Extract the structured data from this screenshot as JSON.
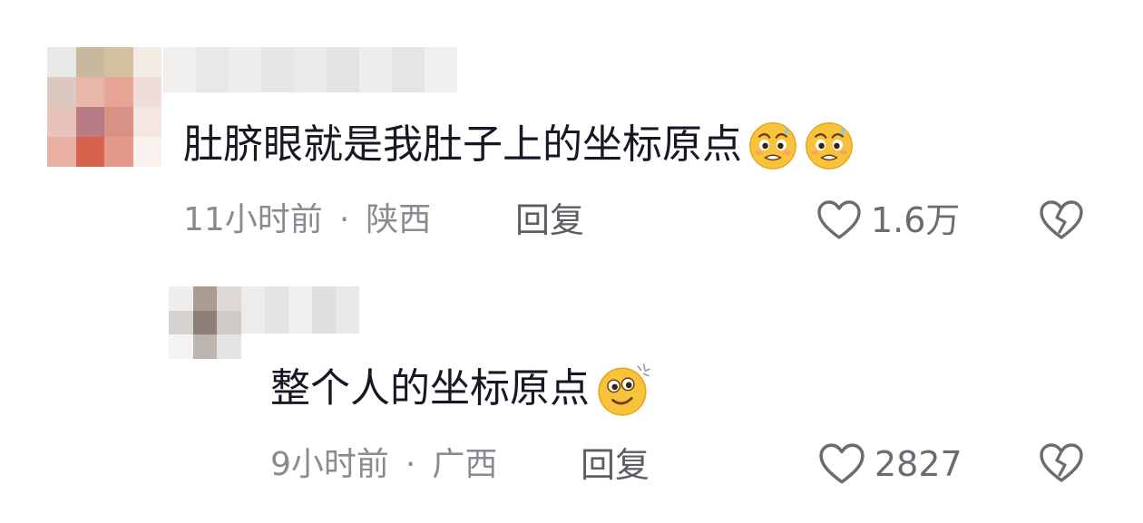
{
  "comments": [
    {
      "text": "肚脐眼就是我肚子上的坐标原点",
      "emojis": [
        "pleading-sweat-emoji",
        "pleading-sweat-emoji"
      ],
      "time": "11小时前",
      "separator": "·",
      "location": "陕西",
      "reply_label": "回复",
      "like_count": "1.6万"
    },
    {
      "text": "整个人的坐标原点",
      "emojis": [
        "sparkle-smile-emoji"
      ],
      "time": "9小时前",
      "separator": "·",
      "location": "广西",
      "reply_label": "回复",
      "like_count": "2827"
    }
  ],
  "colors": {
    "text_primary": "#161823",
    "text_secondary": "#8a8b91",
    "emoji_yellow": "#f7c33a"
  }
}
